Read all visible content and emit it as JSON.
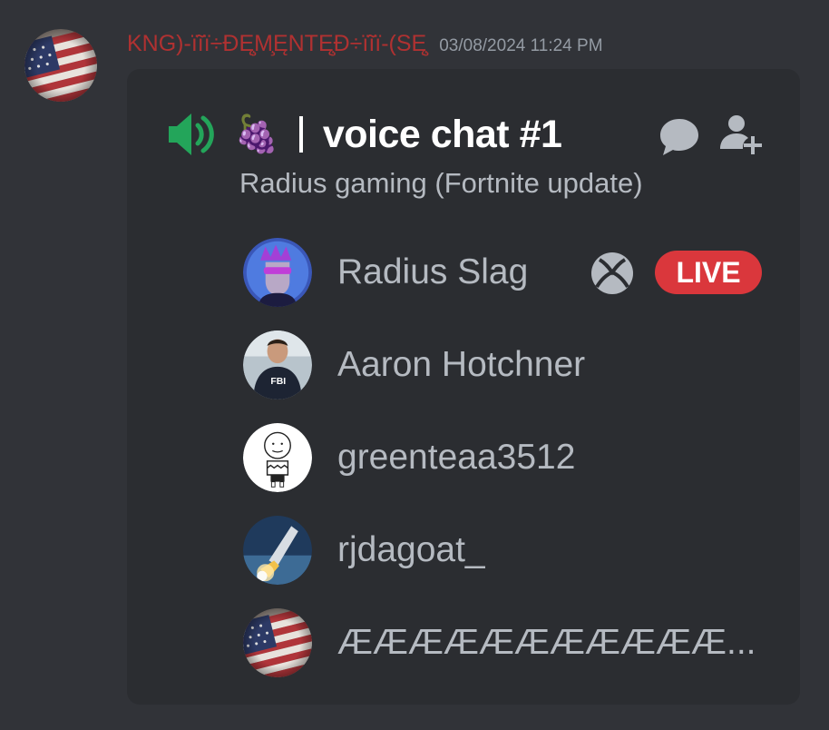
{
  "message": {
    "author": "KNG)-ïĩï÷ĐĘ̧M̧ĘNTĘ̧Đ÷ïĩï-(SĘ̧",
    "author_color": "#b03131",
    "timestamp": "03/08/2024 11:24 PM",
    "author_avatar_icon": "american-flag-avatar"
  },
  "embed": {
    "channel_icon": "speaker-icon",
    "channel_emoji": "🍇",
    "channel_name": "voice chat #1",
    "channel_description": "Radius gaming (Fortnite update)",
    "actions": [
      "chat-icon",
      "invite-person-icon"
    ],
    "participants": [
      {
        "name": "Radius Slag",
        "avatar": "purple-cyberpunk-avatar",
        "platform": "xbox-icon",
        "status": "LIVE"
      },
      {
        "name": "Aaron Hotchner",
        "avatar": "fbi-agent-avatar"
      },
      {
        "name": "greenteaa3512",
        "avatar": "charlie-brown-avatar"
      },
      {
        "name": "rjdagoat_",
        "avatar": "rocket-launch-avatar"
      },
      {
        "name": "ÆÆÆÆÆÆÆÆÆÆÆ...",
        "avatar": "american-flag-avatar"
      }
    ]
  },
  "colors": {
    "background": "#313338",
    "embed_background": "#2b2d31",
    "speaker_green": "#23a55a",
    "live_red": "#da373c",
    "muted_text": "#b5bac1",
    "timestamp_text": "#949ba4"
  }
}
